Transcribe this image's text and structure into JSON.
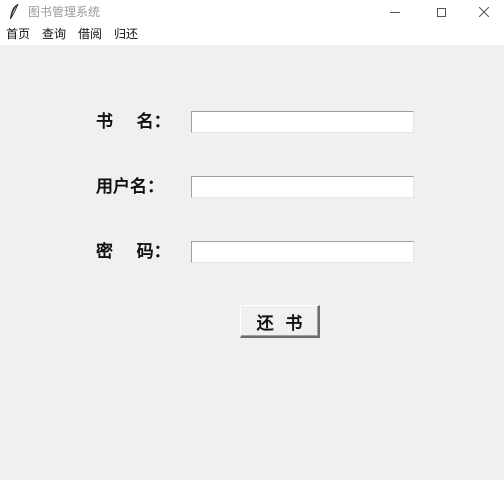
{
  "window": {
    "title": "图书管理系统",
    "icon": "feather-icon"
  },
  "menu": {
    "items": [
      "首页",
      "查询",
      "借阅",
      "归还"
    ]
  },
  "form": {
    "book_label": "书    名：",
    "user_label": "用户名：",
    "password_label": "密    码：",
    "book_value": "",
    "user_value": "",
    "password_value": ""
  },
  "actions": {
    "return_label": "还  书"
  }
}
